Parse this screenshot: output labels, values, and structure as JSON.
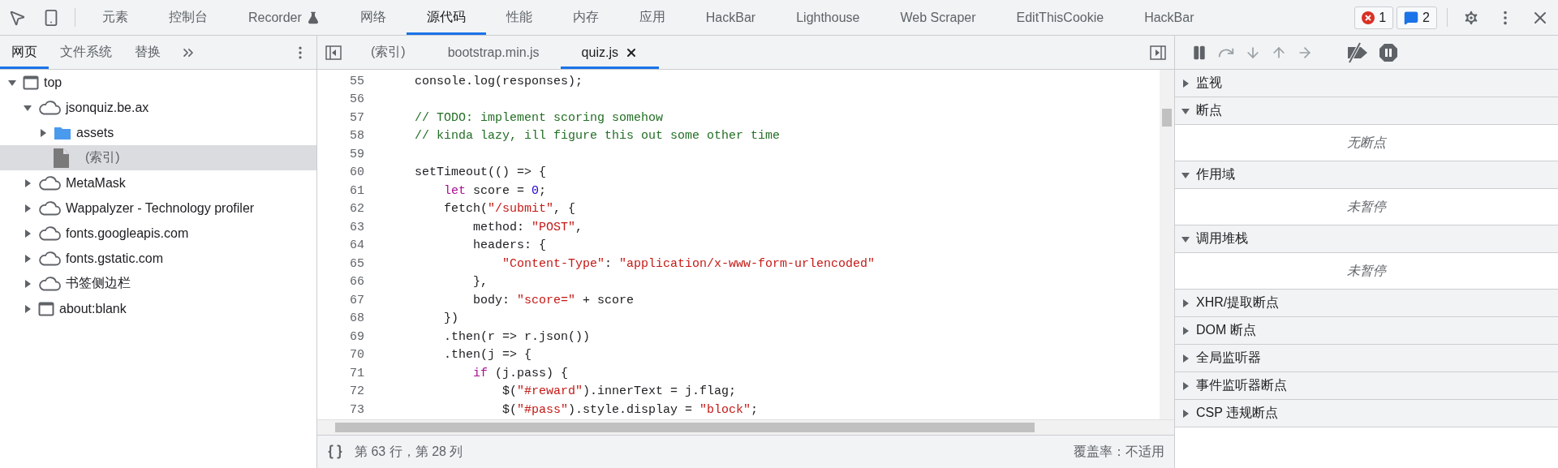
{
  "main_tabs": [
    {
      "label": "元素",
      "selected": false,
      "kind": "plain"
    },
    {
      "label": "控制台",
      "selected": false,
      "kind": "plain"
    },
    {
      "label": "Recorder",
      "selected": false,
      "kind": "experimental"
    },
    {
      "label": "网络",
      "selected": false,
      "kind": "plain"
    },
    {
      "label": "源代码",
      "selected": true,
      "kind": "plain"
    },
    {
      "label": "性能",
      "selected": false,
      "kind": "plain"
    },
    {
      "label": "内存",
      "selected": false,
      "kind": "plain"
    },
    {
      "label": "应用",
      "selected": false,
      "kind": "plain"
    },
    {
      "label": "HackBar",
      "selected": false,
      "kind": "plain"
    },
    {
      "label": "Lighthouse",
      "selected": false,
      "kind": "plain"
    },
    {
      "label": "Web Scraper",
      "selected": false,
      "kind": "plain"
    },
    {
      "label": "EditThisCookie",
      "selected": false,
      "kind": "plain"
    },
    {
      "label": "HackBar",
      "selected": false,
      "kind": "plain"
    }
  ],
  "counters": [
    {
      "kind": "error",
      "count": "1"
    },
    {
      "kind": "message",
      "count": "2"
    }
  ],
  "navigator": {
    "tabs": [
      {
        "label": "网页",
        "selected": true
      },
      {
        "label": "文件系统",
        "selected": false
      },
      {
        "label": "替换",
        "selected": false
      }
    ],
    "tree": [
      {
        "label": "top",
        "kind": "frame",
        "expanded": true,
        "selected": false,
        "children": [
          {
            "label": "jsonquiz.be.ax",
            "kind": "origin",
            "expanded": true,
            "selected": false,
            "children": [
              {
                "label": "assets",
                "kind": "folder",
                "expanded": false,
                "selected": false
              },
              {
                "label": "(索引)",
                "kind": "file",
                "selected": true
              }
            ]
          },
          {
            "label": "MetaMask",
            "kind": "origin",
            "expanded": false,
            "selected": false
          },
          {
            "label": "Wappalyzer - Technology profiler",
            "kind": "origin",
            "expanded": false,
            "selected": false
          },
          {
            "label": "fonts.googleapis.com",
            "kind": "origin",
            "expanded": false,
            "selected": false
          },
          {
            "label": "fonts.gstatic.com",
            "kind": "origin",
            "expanded": false,
            "selected": false
          },
          {
            "label": "书签侧边栏",
            "kind": "origin",
            "expanded": false,
            "selected": false
          },
          {
            "label": "about:blank",
            "kind": "frame",
            "expanded": false,
            "selected": false
          }
        ]
      }
    ]
  },
  "editor": {
    "tabs": [
      {
        "label": "(索引)",
        "selected": false,
        "closable": false
      },
      {
        "label": "bootstrap.min.js",
        "selected": false,
        "closable": false
      },
      {
        "label": "quiz.js",
        "selected": true,
        "closable": true
      }
    ],
    "lines": [
      {
        "number": "55",
        "tokens": [
          {
            "kind": "plain",
            "text": "    console.log(responses);"
          }
        ]
      },
      {
        "number": "56"
      },
      {
        "number": "57",
        "tokens": [
          {
            "kind": "comment",
            "text": "    // TODO: implement scoring somehow"
          }
        ]
      },
      {
        "number": "58",
        "tokens": [
          {
            "kind": "comment",
            "text": "    // kinda lazy, ill figure this out some other time"
          }
        ]
      },
      {
        "number": "59"
      },
      {
        "number": "60",
        "tokens": [
          {
            "kind": "plain",
            "text": "    setTimeout(() => {"
          }
        ]
      },
      {
        "number": "61",
        "tokens": [
          {
            "kind": "keyword",
            "text": "        let"
          },
          {
            "kind": "plain",
            "text": " score = "
          },
          {
            "kind": "number",
            "text": "0"
          },
          {
            "kind": "plain",
            "text": ";"
          }
        ]
      },
      {
        "number": "62",
        "tokens": [
          {
            "kind": "plain",
            "text": "        fetch("
          },
          {
            "kind": "string",
            "text": "\"/submit\""
          },
          {
            "kind": "plain",
            "text": ", {"
          }
        ]
      },
      {
        "number": "63",
        "tokens": [
          {
            "kind": "plain",
            "text": "            method: "
          },
          {
            "kind": "string",
            "text": "\"POST\""
          },
          {
            "kind": "plain",
            "text": ","
          }
        ]
      },
      {
        "number": "64",
        "tokens": [
          {
            "kind": "plain",
            "text": "            headers: {"
          }
        ]
      },
      {
        "number": "65",
        "tokens": [
          {
            "kind": "string",
            "text": "                \"Content-Type\""
          },
          {
            "kind": "plain",
            "text": ": "
          },
          {
            "kind": "string",
            "text": "\"application/x-www-form-urlencoded\""
          }
        ]
      },
      {
        "number": "66",
        "tokens": [
          {
            "kind": "plain",
            "text": "            },"
          }
        ]
      },
      {
        "number": "67",
        "tokens": [
          {
            "kind": "plain",
            "text": "            body: "
          },
          {
            "kind": "string",
            "text": "\"score=\""
          },
          {
            "kind": "plain",
            "text": " + score"
          }
        ]
      },
      {
        "number": "68",
        "tokens": [
          {
            "kind": "plain",
            "text": "        })"
          }
        ]
      },
      {
        "number": "69",
        "tokens": [
          {
            "kind": "plain",
            "text": "        .then(r => r.json())"
          }
        ]
      },
      {
        "number": "70",
        "tokens": [
          {
            "kind": "plain",
            "text": "        .then(j => {"
          }
        ]
      },
      {
        "number": "71",
        "tokens": [
          {
            "kind": "keyword",
            "text": "            if"
          },
          {
            "kind": "plain",
            "text": " (j.pass) {"
          }
        ]
      },
      {
        "number": "72",
        "tokens": [
          {
            "kind": "plain",
            "text": "                $("
          },
          {
            "kind": "string",
            "text": "\"#reward\""
          },
          {
            "kind": "plain",
            "text": ").innerText = j.flag;"
          }
        ]
      },
      {
        "number": "73",
        "tokens": [
          {
            "kind": "plain",
            "text": "                $("
          },
          {
            "kind": "string",
            "text": "\"#pass\""
          },
          {
            "kind": "plain",
            "text": ").style.display = "
          },
          {
            "kind": "string",
            "text": "\"block\""
          },
          {
            "kind": "plain",
            "text": ";"
          }
        ]
      }
    ],
    "status": {
      "position": "第 63 行，第 28 列",
      "coverage": "覆盖率：不适用"
    }
  },
  "debugger": {
    "sections": [
      {
        "title": "监视",
        "expanded": false
      },
      {
        "title": "断点",
        "expanded": true,
        "message": "无断点"
      },
      {
        "title": "作用域",
        "expanded": true,
        "message": "未暂停"
      },
      {
        "title": "调用堆栈",
        "expanded": true,
        "message": "未暂停"
      },
      {
        "title": "XHR/提取断点",
        "expanded": false
      },
      {
        "title": "DOM 断点",
        "expanded": false
      },
      {
        "title": "全局监听器",
        "expanded": false
      },
      {
        "title": "事件监听器断点",
        "expanded": false
      },
      {
        "title": "CSP 违规断点",
        "expanded": false
      }
    ]
  }
}
